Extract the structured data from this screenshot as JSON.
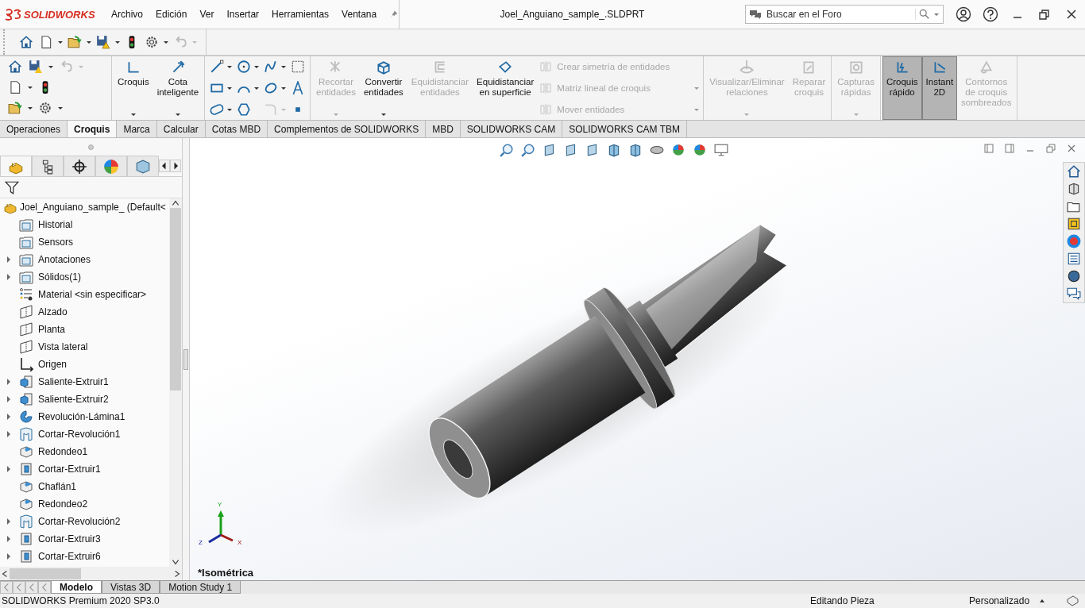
{
  "app": {
    "brand": "SOLIDWORKS"
  },
  "menu": [
    "Archivo",
    "Edición",
    "Ver",
    "Insertar",
    "Herramientas",
    "Ventana"
  ],
  "window": {
    "title": "Joel_Anguiano_sample_.SLDPRT"
  },
  "search": {
    "placeholder": "Buscar en el Foro"
  },
  "ribbon": {
    "groups": [
      {
        "items": [
          {
            "lines": [
              "Croquis"
            ],
            "disabled": false,
            "selected": false,
            "dropdown": true
          },
          {
            "lines": [
              "Cota",
              "inteligente"
            ],
            "disabled": false,
            "selected": false,
            "dropdown": true
          }
        ]
      },
      {
        "items": [
          {
            "lines": [
              "Recortar",
              "entidades"
            ],
            "disabled": true,
            "selected": false,
            "dropdown": true
          },
          {
            "lines": [
              "Convertir",
              "entidades"
            ],
            "disabled": false,
            "selected": false,
            "dropdown": true
          },
          {
            "lines": [
              "Equidistanciar",
              "entidades"
            ],
            "disabled": true,
            "selected": false,
            "dropdown": false
          },
          {
            "lines": [
              "Equidistanciar",
              "en superficie"
            ],
            "disabled": false,
            "selected": false,
            "dropdown": false
          }
        ],
        "rows": [
          {
            "label": "Crear simetría de entidades",
            "disabled": true,
            "dropdown": false
          },
          {
            "label": "Matriz lineal de croquis",
            "disabled": true,
            "dropdown": true
          },
          {
            "label": "Mover entidades",
            "disabled": true,
            "dropdown": true
          }
        ]
      },
      {
        "items": [
          {
            "lines": [
              "Visualizar/Eliminar",
              "relaciones"
            ],
            "disabled": true,
            "selected": false,
            "dropdown": true
          },
          {
            "lines": [
              "Reparar",
              "croquis"
            ],
            "disabled": true,
            "selected": false,
            "dropdown": false
          }
        ]
      },
      {
        "items": [
          {
            "lines": [
              "Capturas",
              "rápidas"
            ],
            "disabled": true,
            "selected": false,
            "dropdown": true
          }
        ]
      },
      {
        "items": [
          {
            "lines": [
              "Croquis",
              "rápido"
            ],
            "disabled": false,
            "selected": true,
            "dropdown": false
          },
          {
            "lines": [
              "Instant",
              "2D"
            ],
            "disabled": false,
            "selected": true,
            "dropdown": false
          },
          {
            "lines": [
              "Contornos",
              "de croquis",
              "sombreados"
            ],
            "disabled": true,
            "selected": false,
            "dropdown": false
          }
        ]
      }
    ]
  },
  "tabs": [
    {
      "label": "Operaciones",
      "selected": false
    },
    {
      "label": "Croquis",
      "selected": true
    },
    {
      "label": "Marca",
      "selected": false
    },
    {
      "label": "Calcular",
      "selected": false
    },
    {
      "label": "Cotas MBD",
      "selected": false
    },
    {
      "label": "Complementos de SOLIDWORKS",
      "selected": false
    },
    {
      "label": "MBD",
      "selected": false
    },
    {
      "label": "SOLIDWORKS CAM",
      "selected": false
    },
    {
      "label": "SOLIDWORKS CAM TBM",
      "selected": false
    }
  ],
  "panel_tabs": [
    {
      "selected": true
    },
    {
      "selected": false
    },
    {
      "selected": false
    },
    {
      "selected": false
    },
    {
      "selected": false
    }
  ],
  "tree": {
    "root": "Joel_Anguiano_sample_  (Default<",
    "items": [
      {
        "label": "Historial",
        "expandable": false
      },
      {
        "label": "Sensors",
        "expandable": false
      },
      {
        "label": "Anotaciones",
        "expandable": true
      },
      {
        "label": "Sólidos(1)",
        "expandable": true
      },
      {
        "label": "Material <sin especificar>",
        "expandable": false
      },
      {
        "label": "Alzado",
        "expandable": false
      },
      {
        "label": "Planta",
        "expandable": false
      },
      {
        "label": "Vista lateral",
        "expandable": false
      },
      {
        "label": "Origen",
        "expandable": false
      },
      {
        "label": "Saliente-Extruir1",
        "expandable": true
      },
      {
        "label": "Saliente-Extruir2",
        "expandable": true
      },
      {
        "label": "Revolución-Lámina1",
        "expandable": true
      },
      {
        "label": "Cortar-Revolución1",
        "expandable": true
      },
      {
        "label": "Redondeo1",
        "expandable": false
      },
      {
        "label": "Cortar-Extruir1",
        "expandable": true
      },
      {
        "label": "Chaflán1",
        "expandable": false
      },
      {
        "label": "Redondeo2",
        "expandable": false
      },
      {
        "label": "Cortar-Revolución2",
        "expandable": true
      },
      {
        "label": "Cortar-Extruir3",
        "expandable": true
      },
      {
        "label": "Cortar-Extruir6",
        "expandable": true
      }
    ]
  },
  "viewport": {
    "view_name": "*Isométrica",
    "triad": {
      "x": "X",
      "y": "Y",
      "z": "Z"
    }
  },
  "bottom_tabs": [
    {
      "label": "Modelo",
      "selected": true
    },
    {
      "label": "Vistas 3D",
      "selected": false
    },
    {
      "label": "Motion Study 1",
      "selected": false
    }
  ],
  "status_bar": {
    "product": "SOLIDWORKS Premium 2020 SP3.0",
    "mode": "Editando Pieza",
    "units": "Personalizado"
  }
}
